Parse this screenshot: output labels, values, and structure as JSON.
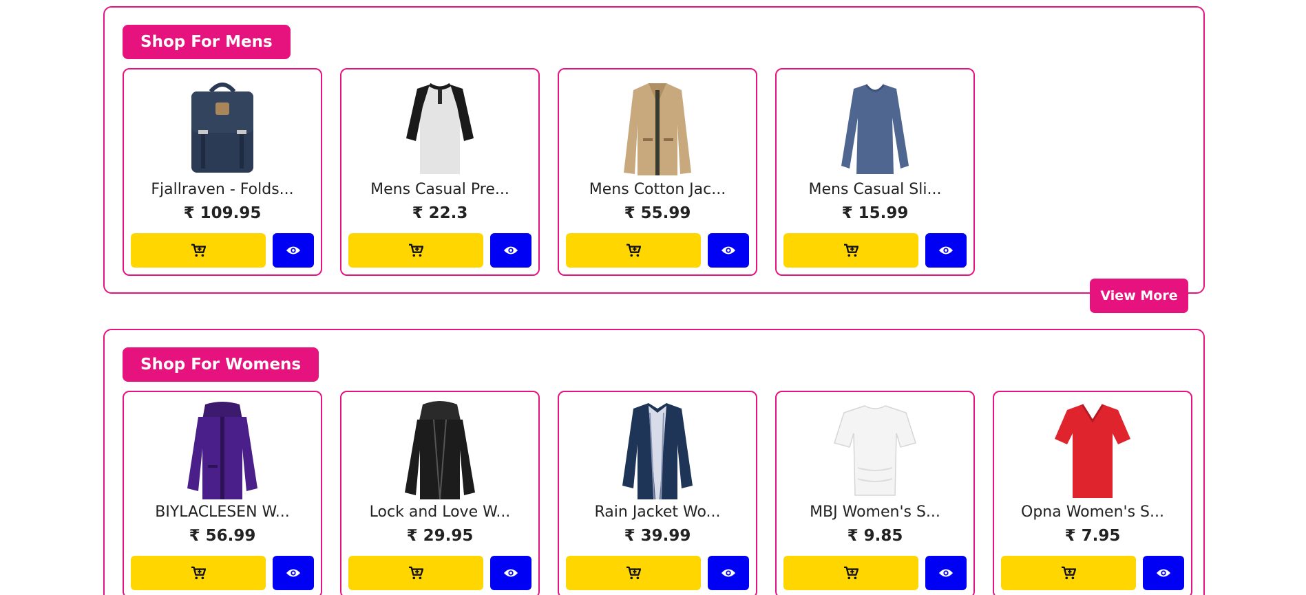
{
  "sections": {
    "mens": {
      "title": "Shop For Mens",
      "view_more_label": "View More",
      "products": [
        {
          "name": "Fjallraven - Folds...",
          "price": "₹ 109.95",
          "image": "backpack"
        },
        {
          "name": "Mens Casual Pre...",
          "price": "₹ 22.3",
          "image": "raglan-tshirt"
        },
        {
          "name": "Mens Cotton Jac...",
          "price": "₹ 55.99",
          "image": "cotton-jacket"
        },
        {
          "name": "Mens Casual Sli...",
          "price": "₹ 15.99",
          "image": "longsleeve-tee"
        }
      ]
    },
    "womens": {
      "title": "Shop For Womens",
      "products": [
        {
          "name": "BIYLACLESEN W...",
          "price": "₹ 56.99",
          "image": "purple-jacket"
        },
        {
          "name": "Lock and Love W...",
          "price": "₹ 29.95",
          "image": "leather-jacket"
        },
        {
          "name": "Rain Jacket Wo...",
          "price": "₹ 39.99",
          "image": "rain-jacket"
        },
        {
          "name": "MBJ Women's S...",
          "price": "₹ 9.85",
          "image": "white-top"
        },
        {
          "name": "Opna Women's S...",
          "price": "₹ 7.95",
          "image": "red-tee"
        }
      ]
    }
  },
  "icons": {
    "cart": "cart-icon",
    "view": "eye-icon"
  },
  "colors": {
    "accent": "#e6137f",
    "cart_button": "#ffd600",
    "view_button": "#0000f5",
    "text": "#222222"
  }
}
